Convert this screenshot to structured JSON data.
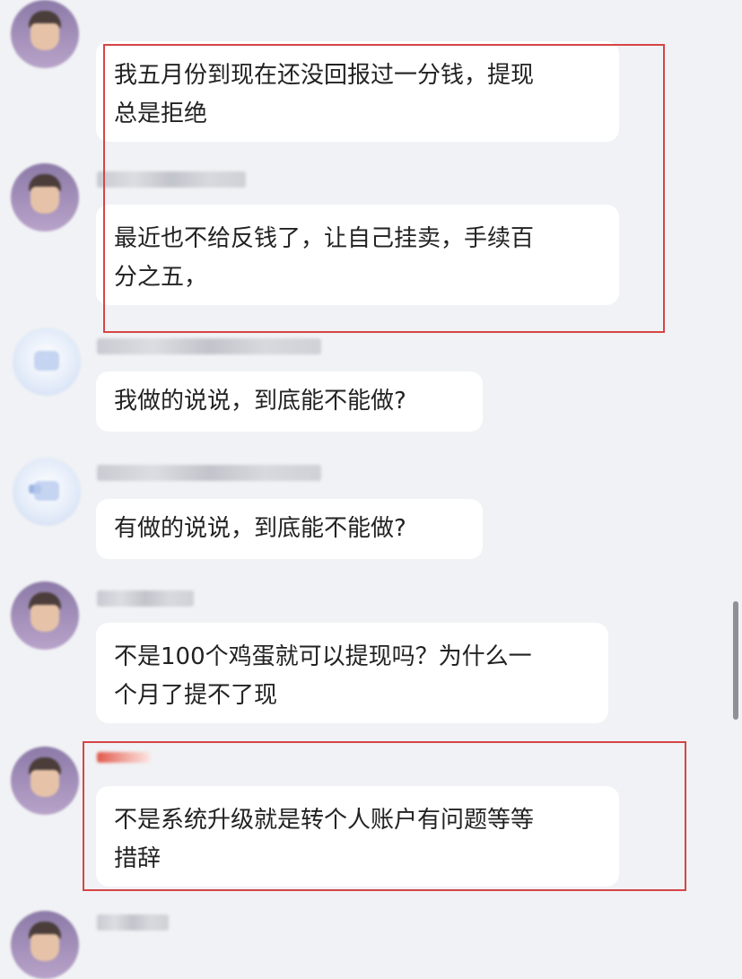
{
  "messages": [
    {
      "text": "我五月份到现在还没回报过一分钱，提现\n总是拒绝"
    },
    {
      "text": "最近也不给反钱了，让自己挂卖，手续百\n分之五，"
    },
    {
      "text": "我做的说说，到底能不能做?"
    },
    {
      "text": "有做的说说，到底能不能做?"
    },
    {
      "text": "不是100个鸡蛋就可以提现吗？为什么一\n个月了提不了现"
    },
    {
      "text": "不是系统升级就是转个人账户有问题等等\n措辞"
    }
  ],
  "colors": {
    "background": "#f1f2f5",
    "bubble": "#ffffff",
    "highlight_border": "#d64545",
    "text": "#222222"
  },
  "icons": [
    "user-avatar-icon",
    "scrollbar"
  ]
}
